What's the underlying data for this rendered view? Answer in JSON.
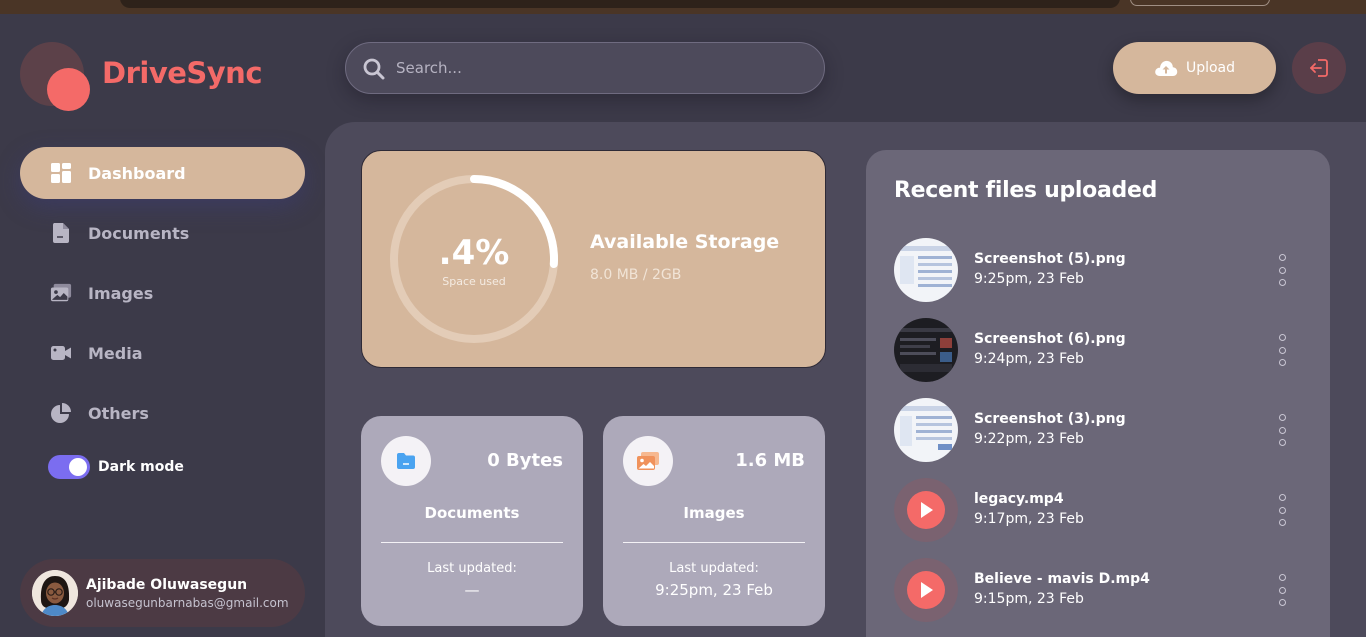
{
  "app": {
    "name": "DriveSync"
  },
  "search": {
    "placeholder": "Search..."
  },
  "header": {
    "upload_label": "Upload"
  },
  "sidebar": {
    "items": [
      {
        "label": "Dashboard",
        "icon": "dashboard-icon",
        "active": true
      },
      {
        "label": "Documents",
        "icon": "document-icon",
        "active": false
      },
      {
        "label": "Images",
        "icon": "image-icon",
        "active": false
      },
      {
        "label": "Media",
        "icon": "video-icon",
        "active": false
      },
      {
        "label": "Others",
        "icon": "pie-chart-icon",
        "active": false
      }
    ],
    "dark_mode": {
      "label": "Dark mode",
      "enabled": true
    }
  },
  "user": {
    "name": "Ajibade Oluwasegun",
    "email": "oluwasegunbarnabas@gmail.com"
  },
  "storage": {
    "percent_label": ".4%",
    "caption": "Space used",
    "title": "Available Storage",
    "value": "8.0 MB / 2GB",
    "ring_fill": 0.26
  },
  "stats": {
    "documents": {
      "size": "0 Bytes",
      "label": "Documents",
      "updated_label": "Last updated:",
      "updated_value": "—"
    },
    "images": {
      "size": "1.6 MB",
      "label": "Images",
      "updated_label": "Last updated:",
      "updated_value": "9:25pm, 23 Feb"
    }
  },
  "recent": {
    "title": "Recent files uploaded",
    "files": [
      {
        "name": "Screenshot (5).png",
        "time": "9:25pm, 23 Feb",
        "kind": "image-light"
      },
      {
        "name": "Screenshot (6).png",
        "time": "9:24pm, 23 Feb",
        "kind": "image-dark"
      },
      {
        "name": "Screenshot (3).png",
        "time": "9:22pm, 23 Feb",
        "kind": "image-light"
      },
      {
        "name": "legacy.mp4",
        "time": "9:17pm, 23 Feb",
        "kind": "video"
      },
      {
        "name": "Believe - mavis D.mp4",
        "time": "9:15pm, 23 Feb",
        "kind": "video"
      }
    ]
  },
  "colors": {
    "accent": "#d5b79c",
    "brand": "#f46a68",
    "toggle": "#7b6df0",
    "background": "#3c3a49"
  }
}
